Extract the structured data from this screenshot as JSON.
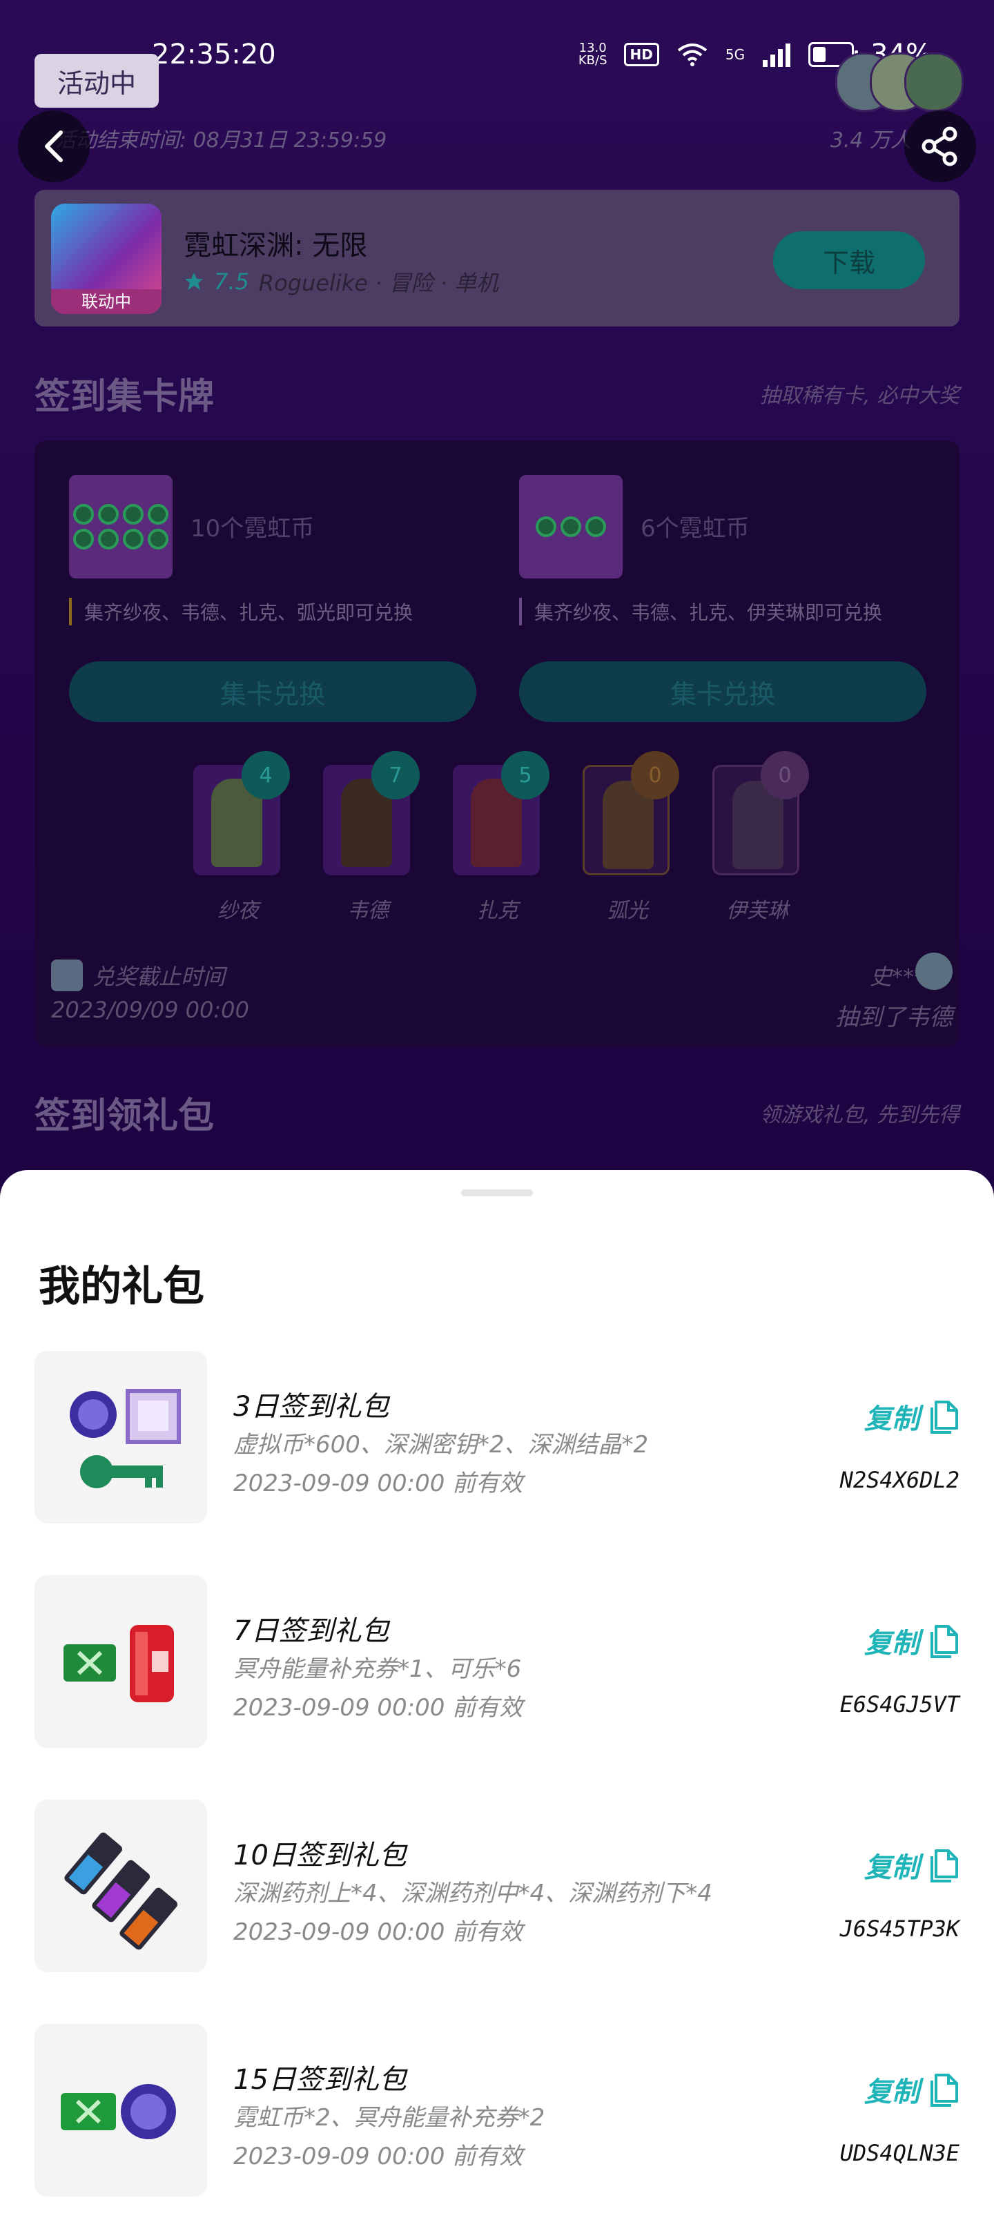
{
  "status_bar": {
    "time": "22:35:20",
    "net_speed_value": "13.0",
    "net_speed_unit": "KB/S",
    "hd": "HD",
    "network": "5G",
    "battery": "34%"
  },
  "activity": {
    "badge": "活动中",
    "end_time": "活动结束时间: 08月31日 23:59:59",
    "participants": "3.4 万人"
  },
  "game": {
    "title": "霓虹深渊: 无限",
    "icon_tag": "联动中",
    "rating": "7.5",
    "tags": "Roguelike · 冒险 · 单机",
    "download_label": "下载"
  },
  "sign_cards": {
    "title": "签到集卡牌",
    "subtitle": "抽取稀有卡, 必中大奖",
    "rewards": [
      {
        "name": "10个霓虹币",
        "desc": "集齐纱夜、韦德、扎克、弧光即可兑换",
        "button": "集卡兑换"
      },
      {
        "name": "6个霓虹币",
        "desc": "集齐纱夜、韦德、扎克、伊芙琳即可兑换",
        "button": "集卡兑换"
      }
    ],
    "characters": [
      {
        "name": "纱夜",
        "count": "4"
      },
      {
        "name": "韦德",
        "count": "7"
      },
      {
        "name": "扎克",
        "count": "5"
      },
      {
        "name": "弧光",
        "count": "0"
      },
      {
        "name": "伊芙琳",
        "count": "0"
      }
    ],
    "deadline_label": "兑奖截止时间",
    "deadline_value": "2023/09/09 00:00",
    "winner_name": "史***",
    "winner_text": "抽到了韦德"
  },
  "sign_gifts": {
    "title": "签到领礼包",
    "subtitle": "领游戏礼包, 先到先得"
  },
  "my_gifts": {
    "title": "我的礼包",
    "items": [
      {
        "name": "3日签到礼包",
        "contents": "虚拟币*600、深渊密钥*2、深渊结晶*2",
        "expiry": "2023-09-09 00:00 前有效",
        "copy_label": "复制",
        "code": "N2S4X6DL2"
      },
      {
        "name": "7日签到礼包",
        "contents": "冥舟能量补充券*1、可乐*6",
        "expiry": "2023-09-09 00:00 前有效",
        "copy_label": "复制",
        "code": "E6S4GJ5VT"
      },
      {
        "name": "10日签到礼包",
        "contents": "深渊药剂上*4、深渊药剂中*4、深渊药剂下*4",
        "expiry": "2023-09-09 00:00 前有效",
        "copy_label": "复制",
        "code": "J6S45TP3K"
      },
      {
        "name": "15日签到礼包",
        "contents": "霓虹币*2、冥舟能量补充券*2",
        "expiry": "2023-09-09 00:00 前有效",
        "copy_label": "复制",
        "code": "UDS4QLN3E"
      }
    ]
  },
  "colors": {
    "accent_teal": "#1fb5b8",
    "page_purple": "#2a0a55",
    "sheet_white": "#ffffff"
  }
}
